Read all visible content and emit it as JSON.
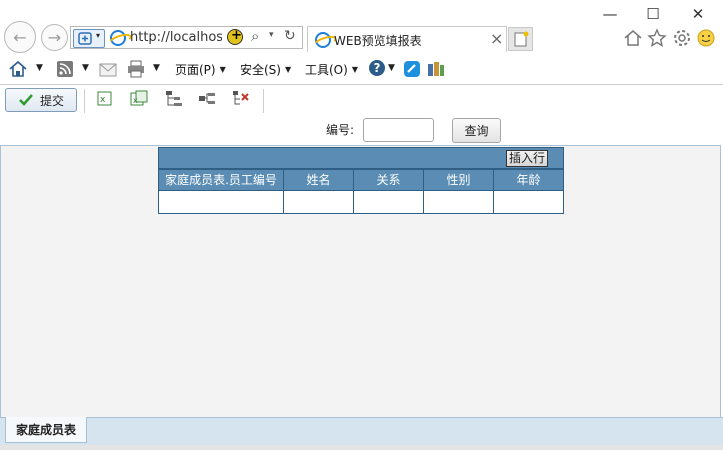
{
  "window": {
    "controls": {
      "minimize": "—",
      "maximize": "☐",
      "close": "✕"
    }
  },
  "browser": {
    "address": "http://localhost:",
    "tab_title": "WEB预览填报表",
    "tab_close": "×",
    "search_glyph": "⌕",
    "dropdown_glyph": "▾",
    "refresh_glyph": "↻"
  },
  "command_bar": {
    "page_menu": "页面(P)",
    "safety_menu": "安全(S)",
    "tools_menu": "工具(O)",
    "help_glyph": "?"
  },
  "report_toolbar": {
    "submit_label": "提交"
  },
  "query": {
    "label": "编号:",
    "input_value": "",
    "button_label": "查询"
  },
  "grid": {
    "insert_row_label": "插入行",
    "columns": [
      "家庭成员表.员工编号",
      "姓名",
      "关系",
      "性别",
      "年龄"
    ],
    "rows": [
      [
        "",
        "",
        "",
        "",
        ""
      ]
    ]
  },
  "sheet_tabs": {
    "active": "家庭成员表"
  },
  "colors": {
    "grid_header": "#5b8db4",
    "grid_border": "#2f5f85",
    "sheet_bar": "#d6e4f0"
  }
}
